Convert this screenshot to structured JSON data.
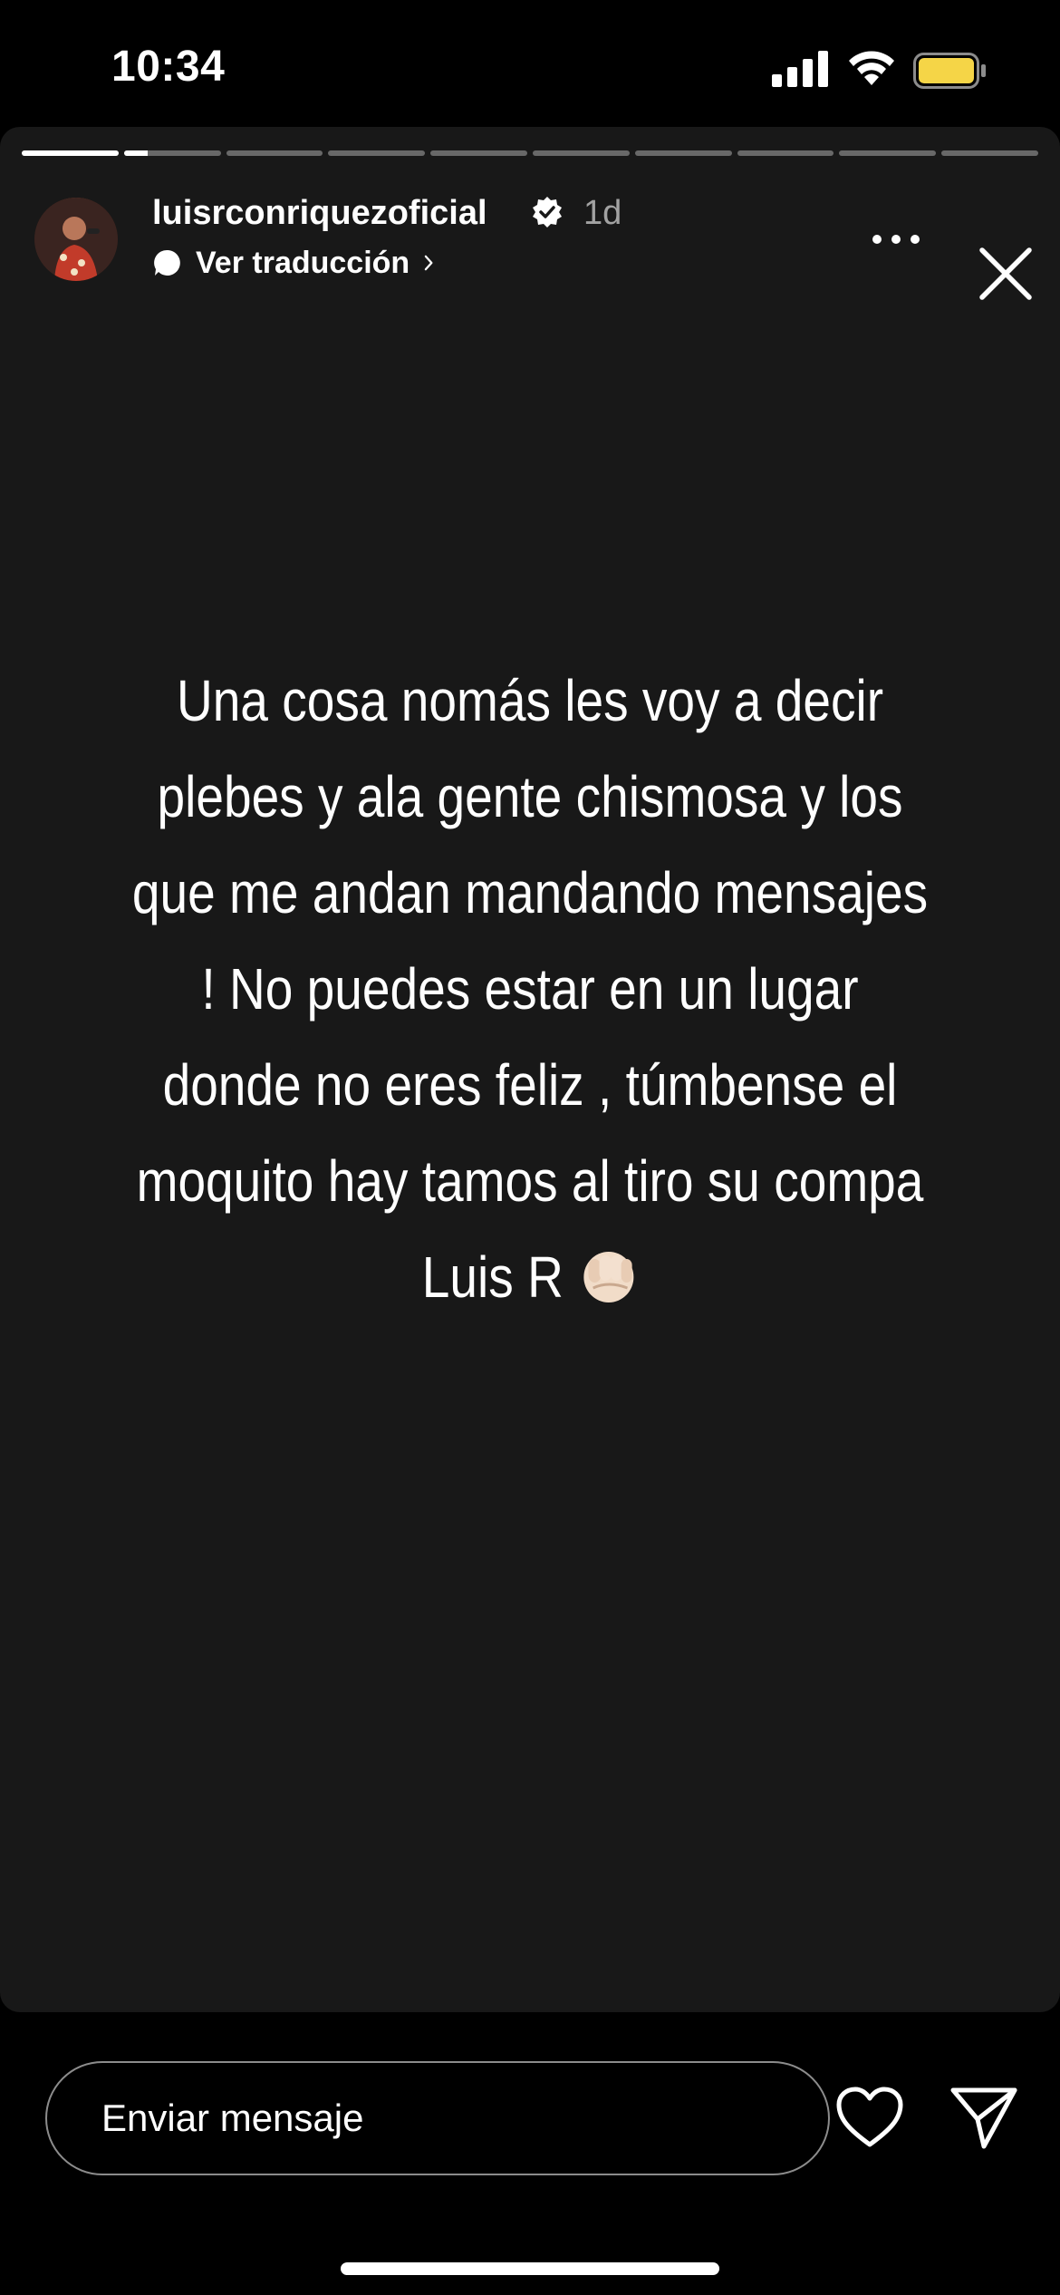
{
  "status_bar": {
    "time": "10:34",
    "battery_color": "#f5d547"
  },
  "story": {
    "progress": {
      "segments": 10,
      "current_index": 1,
      "current_fraction": 0.25
    },
    "header": {
      "username": "luisrconriquezoficial",
      "age": "1d",
      "translate_label": "Ver traducción",
      "verified": true
    },
    "text": "Una cosa nomás les voy a decir plebes y ala gente chismosa y los que me andan mandando mensajes ! No puedes estar en un lugar donde no eres feliz , túmbense el moquito hay tamos al tiro su compa Luis R",
    "emoji": "fist-icon"
  },
  "reply_bar": {
    "placeholder": "Enviar mensaje"
  },
  "colors": {
    "background": "#000000",
    "story_background": "#181818"
  }
}
